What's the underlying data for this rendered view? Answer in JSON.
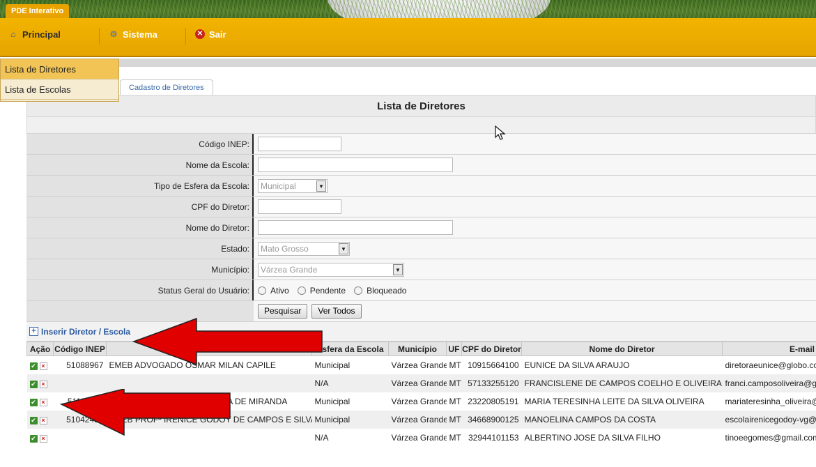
{
  "header": {
    "app_tab": "PDE Interativo"
  },
  "menu": {
    "items": [
      {
        "label": "Principal",
        "icon": "home-icon"
      },
      {
        "label": "Sistema",
        "icon": "gear-icon"
      },
      {
        "label": "Sair",
        "icon": "exit-icon"
      }
    ],
    "dropdown": [
      "Lista de Diretores",
      "Lista de Escolas"
    ]
  },
  "page_tab": "Cadastro de Diretores",
  "page_title": "Lista de Diretores",
  "form": {
    "codigo_inep_label": "Código INEP:",
    "nome_escola_label": "Nome da Escola:",
    "tipo_esfera_label": "Tipo de Esfera da Escola:",
    "tipo_esfera_value": "Municipal",
    "cpf_label": "CPF do Diretor:",
    "nome_diretor_label": "Nome do Diretor:",
    "estado_label": "Estado:",
    "estado_value": "Mato Grosso",
    "municipio_label": "Município:",
    "municipio_value": "Várzea Grande",
    "status_label": "Status Geral do Usuário:",
    "status_options": [
      "Ativo",
      "Pendente",
      "Bloqueado"
    ],
    "pesquisar_button": "Pesquisar",
    "ver_todos_button": "Ver Todos"
  },
  "insert_link": "Inserir Diretor / Escola",
  "table": {
    "headers": [
      "Ação",
      "Código INEP",
      "Nome da Escola",
      "Esfera da Escola",
      "Município",
      "UF",
      "CPF do Diretor",
      "Nome do Diretor",
      "E-mail"
    ],
    "rows": [
      {
        "codigo": "51088967",
        "escola": "EMEB ADVOGADO OSMAR MILAN CAPILE",
        "esfera": "Municipal",
        "municipio": "Várzea Grande",
        "uf": "MT",
        "cpf": "10915664100",
        "diretor": "EUNICE DA SILVA ARAUJO",
        "email": "diretoraeunice@globo.co"
      },
      {
        "codigo": "",
        "escola": "",
        "esfera": "N/A",
        "municipio": "Várzea Grande",
        "uf": "MT",
        "cpf": "57133255120",
        "diretor": "FRANCISLENE DE CAMPOS COELHO E OLIVEIRA",
        "email": "franci.camposoliveira@gr"
      },
      {
        "codigo": "51116804",
        "escola": "EMEB PROFª MARIA PEDROSA DE MIRANDA",
        "esfera": "Municipal",
        "municipio": "Várzea Grande",
        "uf": "MT",
        "cpf": "23220805191",
        "diretor": "MARIA TERESINHA LEITE DA SILVA OLIVEIRA",
        "email": "mariateresinha_oliveira@"
      },
      {
        "codigo": "51042452",
        "escola": "EMEB PROFª IRENICE GODOY DE CAMPOS E SILVA",
        "esfera": "Municipal",
        "municipio": "Várzea Grande",
        "uf": "MT",
        "cpf": "34668900125",
        "diretor": "MANOELINA CAMPOS DA COSTA",
        "email": "escolairenicegodoy-vg@"
      },
      {
        "codigo": "",
        "escola": "",
        "esfera": "N/A",
        "municipio": "Várzea Grande",
        "uf": "MT",
        "cpf": "32944101153",
        "diretor": "ALBERTINO JOSE DA SILVA FILHO",
        "email": "tinoeegomes@gmail.com"
      }
    ]
  },
  "colors": {
    "menu_bar": "#f2b300",
    "annotation_arrow": "#e00000",
    "link": "#2c5aa0"
  }
}
